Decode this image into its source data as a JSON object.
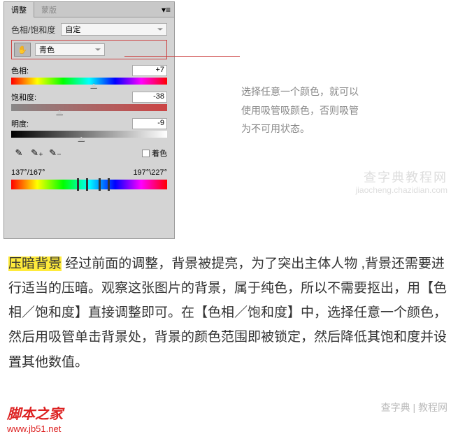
{
  "tabs": {
    "active": "调整",
    "inactive": "蒙版"
  },
  "title_row": {
    "label": "色相/饱和度",
    "preset": "自定"
  },
  "color_select": {
    "value": "青色"
  },
  "sliders": {
    "hue": {
      "label": "色相:",
      "value": "+7"
    },
    "saturation": {
      "label": "饱和度:",
      "value": "-38"
    },
    "lightness": {
      "label": "明度:",
      "value": "-9"
    }
  },
  "colorize": {
    "label": "着色"
  },
  "range": {
    "left": "137°/167°",
    "right": "197°\\227°"
  },
  "annotation": "选择任意一个颜色，就可以使用吸管吸颜色，否则吸管为不可用状态。",
  "article": {
    "highlight": "压暗背景",
    "body": " 经过前面的调整，背景被提亮，为了突出主体人物 ,背景还需要进行适当的压暗。观察这张图片的背景，属于纯色，所以不需要抠出，用【色相／饱和度】直接调整即可。在【色相／饱和度】中，选择任意一个颜色，然后用吸管单击背景处，背景的颜色范围即被锁定，然后降低其饱和度并设置其他数值。"
  },
  "watermark": {
    "main": "查字典教程网",
    "sub": "jiaocheng.chazidian.com"
  },
  "footer": {
    "brand": "脚本之家",
    "url": "www.jb51.net",
    "right": "查字典 | 教程网"
  }
}
